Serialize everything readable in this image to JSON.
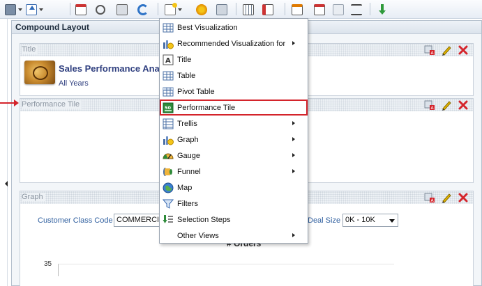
{
  "toolbar": {
    "buttons": [
      {
        "name": "print-icon"
      },
      {
        "name": "export-icon"
      },
      {
        "name": "schedule-icon"
      },
      {
        "name": "preview-icon"
      },
      {
        "name": "print-options-icon"
      },
      {
        "name": "refresh-icon"
      },
      {
        "name": "new-view-icon"
      },
      {
        "name": "add-view-icon"
      },
      {
        "name": "view-properties-icon"
      },
      {
        "name": "edit-columns-icon"
      },
      {
        "name": "edit-view-icon"
      },
      {
        "name": "layout-icon"
      },
      {
        "name": "report-icon"
      },
      {
        "name": "delete-view-icon"
      },
      {
        "name": "prompt-icon"
      },
      {
        "name": "download-icon"
      }
    ]
  },
  "compound": {
    "title": "Compound Layout"
  },
  "views": {
    "title_view": {
      "label": "Title",
      "heading": "Sales Performance Analysis",
      "subtitle": "All Years"
    },
    "performance_tile_view": {
      "label": "Performance Tile"
    },
    "graph_view": {
      "label": "Graph",
      "prompt1_label": "Customer Class Code",
      "prompt1_value": "COMMERCIAL",
      "prompt2_label": "Deal Size",
      "prompt2_value": "0K - 10K",
      "chart_title": "# Orders",
      "y_tick": "35"
    }
  },
  "menu": {
    "items": [
      {
        "label": "Best Visualization",
        "icon": "table-grid-icon",
        "submenu": false
      },
      {
        "label": "Recommended Visualization for",
        "icon": "recommended-chart-icon",
        "submenu": true
      },
      {
        "label": "Title",
        "icon": "title-icon",
        "submenu": false
      },
      {
        "label": "Table",
        "icon": "table-icon",
        "submenu": false
      },
      {
        "label": "Pivot Table",
        "icon": "pivot-table-icon",
        "submenu": false
      },
      {
        "label": "Performance Tile",
        "icon": "performance-tile-icon",
        "submenu": false
      },
      {
        "label": "Trellis",
        "icon": "trellis-icon",
        "submenu": true
      },
      {
        "label": "Graph",
        "icon": "graph-icon",
        "submenu": true
      },
      {
        "label": "Gauge",
        "icon": "gauge-icon",
        "submenu": true
      },
      {
        "label": "Funnel",
        "icon": "funnel-icon",
        "submenu": true
      },
      {
        "label": "Map",
        "icon": "map-icon",
        "submenu": false
      },
      {
        "label": "Filters",
        "icon": "filters-icon",
        "submenu": false
      },
      {
        "label": "Selection Steps",
        "icon": "selection-steps-icon",
        "submenu": false
      },
      {
        "label": "Other Views",
        "icon": "",
        "submenu": true
      }
    ],
    "highlighted": "Performance Tile"
  },
  "colors": {
    "highlight": "#d4242b",
    "title_text": "#2f3f7f",
    "prompt_label": "#2f5f9f"
  }
}
